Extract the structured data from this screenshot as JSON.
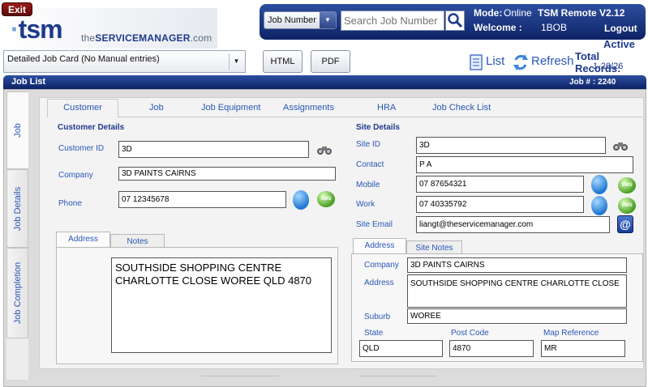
{
  "header": {
    "exit_label": "Exit",
    "logo_main": "tsm",
    "logo_sub_the": "the",
    "logo_sub_brand": "SERVICEMANAGER",
    "logo_sub_domain": ".com",
    "search_type_selected": "Job Number",
    "search_placeholder": "Search Job Number",
    "mode_label": "Mode:",
    "mode_value": "Online",
    "app_version": "TSM Remote V2.12",
    "welcome_label": "Welcome :",
    "welcome_user": "1BOB",
    "logout_label": "Logout"
  },
  "toolbar": {
    "job_card_selected": "Detailed Job Card (No Manual entries)",
    "html_label": "HTML",
    "pdf_label": "PDF",
    "list_label": "List",
    "refresh_label": "Refresh",
    "status": "Active",
    "total_records_label": "Total Records:",
    "total_records_value": "1-26/26"
  },
  "job_list": {
    "title": "Job List",
    "job_number_label": "Job # :",
    "job_number_value": "2240"
  },
  "side_tabs": [
    "Job",
    "Job Details",
    "Job Completion"
  ],
  "top_tabs": [
    "Customer",
    "Job",
    "Job Equipment",
    "Assignments",
    "HRA",
    "Job Check List"
  ],
  "customer": {
    "section_title": "Customer Details",
    "id_label": "Customer ID",
    "id_value": "3D",
    "company_label": "Company",
    "company_value": "3D PAINTS CAIRNS",
    "phone_label": "Phone",
    "phone_value": "07 12345678",
    "address_tab": "Address",
    "notes_tab": "Notes",
    "address_line1": "SOUTHSIDE SHOPPING CENTRE",
    "address_line2": "CHARLOTTE CLOSE  WOREE  QLD  4870"
  },
  "site": {
    "section_title": "Site Details",
    "id_label": "Site ID",
    "id_value": "3D",
    "contact_label": "Contact",
    "contact_value": "P A",
    "mobile_label": "Mobile",
    "mobile_value": "07 87654321",
    "work_label": "Work",
    "work_value": "07 40335792",
    "email_label": "Site Email",
    "email_value": "liangt@theservicemanager.com",
    "address_tab": "Address",
    "notes_tab": "Site Notes",
    "company_label": "Company",
    "company_value": "3D PAINTS CAIRNS",
    "address_label": "Address",
    "address_value": "SOUTHSIDE SHOPPING CENTRE CHARLOTTE CLOSE",
    "suburb_label": "Suburb",
    "suburb_value": "WOREE",
    "state_label": "State",
    "state_value": "QLD",
    "postcode_label": "Post Code",
    "postcode_value": "4870",
    "mapref_label": "Map Reference",
    "mapref_value": "MR"
  },
  "icons": {
    "sms_text": "SMS",
    "email_text": "@"
  }
}
